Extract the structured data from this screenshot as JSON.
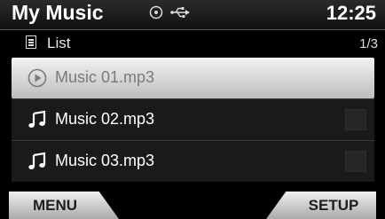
{
  "header": {
    "title": "My Music",
    "clock": "12:25",
    "status_icons": [
      "disc-icon",
      "usb-icon"
    ]
  },
  "subheader": {
    "icon": "list-icon",
    "label": "List",
    "page": "1/3"
  },
  "tracks": [
    {
      "label": "Music 01.mp3",
      "icon": "play-circle-icon",
      "state": "selected"
    },
    {
      "label": "Music 02.mp3",
      "icon": "music-note-icon",
      "state": "normal"
    },
    {
      "label": "Music 03.mp3",
      "icon": "music-note-icon",
      "state": "normal"
    }
  ],
  "softkeys": {
    "menu_label": "MENU",
    "setup_label": "SETUP"
  },
  "colors": {
    "selected_row_top": "#f2f2f2",
    "selected_row_bottom": "#bdbdbd",
    "row_background": "#1a1a1a",
    "softkey_top": "#f1f1f1",
    "softkey_bottom": "#a9a9a9"
  }
}
